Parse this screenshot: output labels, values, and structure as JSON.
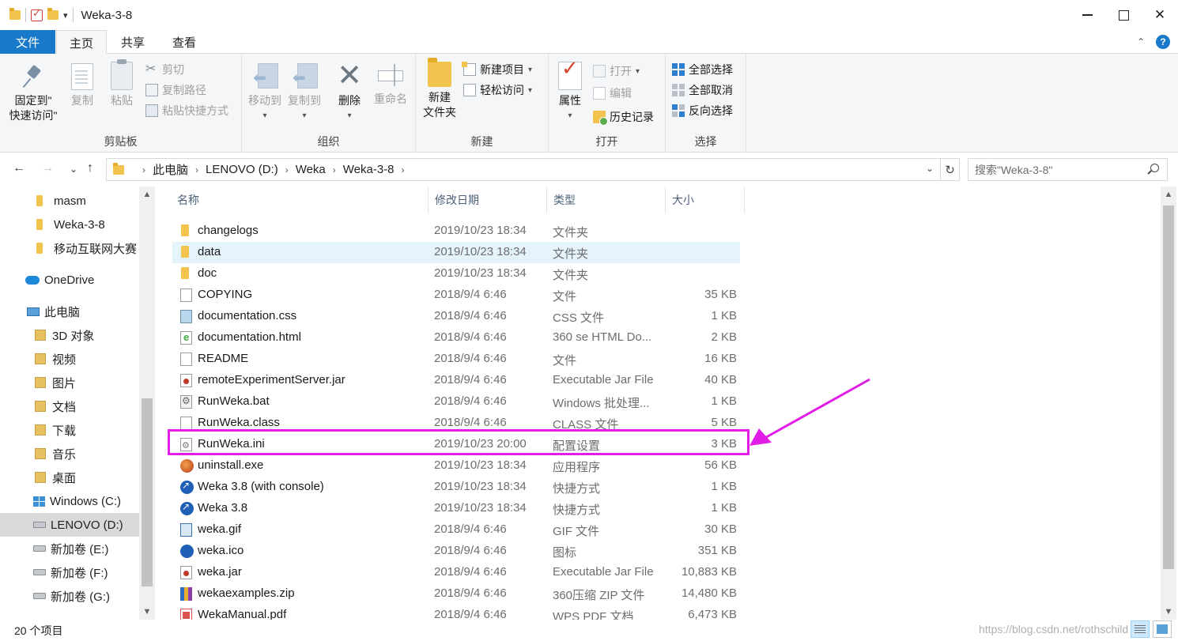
{
  "window": {
    "title": "Weka-3-8",
    "controls": {
      "minimize": "–",
      "close": "✕"
    }
  },
  "tabs": [
    {
      "label": "文件"
    },
    {
      "label": "主页"
    },
    {
      "label": "共享"
    },
    {
      "label": "查看"
    }
  ],
  "ribbon": {
    "clipboard": {
      "label": "剪贴板",
      "pin": "固定到\"快速访问\"",
      "pin_line1": "固定到\"",
      "pin_line2": "快速访问\"",
      "copy": "复制",
      "paste": "粘贴",
      "cut": "剪切",
      "copy_path": "复制路径",
      "paste_shortcut": "粘贴快捷方式"
    },
    "organize": {
      "label": "组织",
      "move_to": "移动到",
      "copy_to": "复制到",
      "delete": "删除",
      "rename": "重命名"
    },
    "new": {
      "label": "新建",
      "new_folder_line1": "新建",
      "new_folder_line2": "文件夹",
      "new_item": "新建项目",
      "easy_access": "轻松访问"
    },
    "open": {
      "label": "打开",
      "properties": "属性",
      "open": "打开",
      "edit": "编辑",
      "history": "历史记录"
    },
    "select": {
      "label": "选择",
      "select_all": "全部选择",
      "select_none": "全部取消",
      "invert": "反向选择"
    }
  },
  "address": {
    "crumbs": [
      "此电脑",
      "LENOVO (D:)",
      "Weka",
      "Weka-3-8"
    ],
    "search_placeholder": "搜索\"Weka-3-8\""
  },
  "nav": {
    "items": [
      {
        "label": "masm",
        "icon": "folder-icon"
      },
      {
        "label": "Weka-3-8",
        "icon": "folder-icon"
      },
      {
        "label": "移动互联网大赛",
        "icon": "folder-icon"
      },
      {
        "label": "OneDrive",
        "icon": "onedrive-icon"
      },
      {
        "label": "此电脑",
        "icon": "this-pc-icon"
      },
      {
        "label": "3D 对象",
        "icon": "3d-objects-icon"
      },
      {
        "label": "视频",
        "icon": "videos-icon"
      },
      {
        "label": "图片",
        "icon": "pictures-icon"
      },
      {
        "label": "文档",
        "icon": "documents-icon"
      },
      {
        "label": "下载",
        "icon": "downloads-icon"
      },
      {
        "label": "音乐",
        "icon": "music-icon"
      },
      {
        "label": "桌面",
        "icon": "desktop-icon"
      },
      {
        "label": "Windows (C:)",
        "icon": "windows-drive-icon"
      },
      {
        "label": "LENOVO (D:)",
        "icon": "drive-icon"
      },
      {
        "label": "新加卷 (E:)",
        "icon": "drive-icon"
      },
      {
        "label": "新加卷 (F:)",
        "icon": "drive-icon"
      },
      {
        "label": "新加卷 (G:)",
        "icon": "drive-icon"
      }
    ],
    "selected": "LENOVO (D:)"
  },
  "columns": {
    "name": "名称",
    "date": "修改日期",
    "type": "类型",
    "size": "大小"
  },
  "files": [
    {
      "name": "changelogs",
      "date": "2019/10/23 18:34",
      "type": "文件夹",
      "size": "",
      "icon": "folder-icon"
    },
    {
      "name": "data",
      "date": "2019/10/23 18:34",
      "type": "文件夹",
      "size": "",
      "icon": "folder-icon"
    },
    {
      "name": "doc",
      "date": "2019/10/23 18:34",
      "type": "文件夹",
      "size": "",
      "icon": "folder-icon"
    },
    {
      "name": "COPYING",
      "date": "2018/9/4 6:46",
      "type": "文件",
      "size": "35 KB",
      "icon": "file-icon"
    },
    {
      "name": "documentation.css",
      "date": "2018/9/4 6:46",
      "type": "CSS 文件",
      "size": "1 KB",
      "icon": "css-file-icon"
    },
    {
      "name": "documentation.html",
      "date": "2018/9/4 6:46",
      "type": "360 se HTML Do...",
      "size": "2 KB",
      "icon": "html-file-icon"
    },
    {
      "name": "README",
      "date": "2018/9/4 6:46",
      "type": "文件",
      "size": "16 KB",
      "icon": "file-icon"
    },
    {
      "name": "remoteExperimentServer.jar",
      "date": "2018/9/4 6:46",
      "type": "Executable Jar File",
      "size": "40 KB",
      "icon": "jar-file-icon"
    },
    {
      "name": "RunWeka.bat",
      "date": "2018/9/4 6:46",
      "type": "Windows 批处理...",
      "size": "1 KB",
      "icon": "bat-file-icon"
    },
    {
      "name": "RunWeka.class",
      "date": "2018/9/4 6:46",
      "type": "CLASS 文件",
      "size": "5 KB",
      "icon": "file-icon"
    },
    {
      "name": "RunWeka.ini",
      "date": "2019/10/23 20:00",
      "type": "配置设置",
      "size": "3 KB",
      "icon": "ini-file-icon"
    },
    {
      "name": "uninstall.exe",
      "date": "2019/10/23 18:34",
      "type": "应用程序",
      "size": "56 KB",
      "icon": "exe-file-icon"
    },
    {
      "name": "Weka 3.8 (with console)",
      "date": "2019/10/23 18:34",
      "type": "快捷方式",
      "size": "1 KB",
      "icon": "shortcut-icon"
    },
    {
      "name": "Weka 3.8",
      "date": "2019/10/23 18:34",
      "type": "快捷方式",
      "size": "1 KB",
      "icon": "shortcut-icon"
    },
    {
      "name": "weka.gif",
      "date": "2018/9/4 6:46",
      "type": "GIF 文件",
      "size": "30 KB",
      "icon": "gif-file-icon"
    },
    {
      "name": "weka.ico",
      "date": "2018/9/4 6:46",
      "type": "图标",
      "size": "351 KB",
      "icon": "ico-file-icon"
    },
    {
      "name": "weka.jar",
      "date": "2018/9/4 6:46",
      "type": "Executable Jar File",
      "size": "10,883 KB",
      "icon": "jar-file-icon"
    },
    {
      "name": "wekaexamples.zip",
      "date": "2018/9/4 6:46",
      "type": "360压缩 ZIP 文件",
      "size": "14,480 KB",
      "icon": "zip-file-icon"
    },
    {
      "name": "WekaManual.pdf",
      "date": "2018/9/4 6:46",
      "type": "WPS PDF 文档",
      "size": "6,473 KB",
      "icon": "pdf-file-icon"
    }
  ],
  "hovered_file": "data",
  "highlighted_file": "RunWeka.ini",
  "annotation_color": "#e21ee6",
  "status": {
    "item_count": "20 个项目",
    "watermark": "https://blog.csdn.net/rothschild"
  }
}
